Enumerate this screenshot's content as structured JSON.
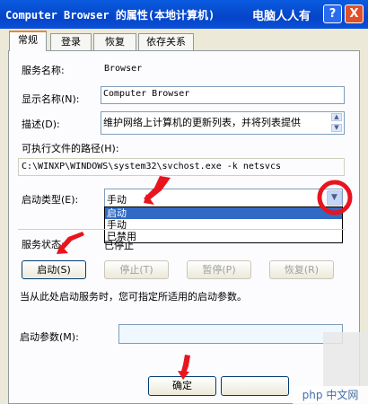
{
  "window": {
    "title": "Computer Browser 的属性(本地计算机)",
    "watermark_top": "电脑人人有",
    "help_label": "?",
    "close_label": "X"
  },
  "tabs": [
    {
      "label": "常规",
      "active": true
    },
    {
      "label": "登录",
      "active": false
    },
    {
      "label": "恢复",
      "active": false
    },
    {
      "label": "依存关系",
      "active": false
    }
  ],
  "general": {
    "service_name_label": "服务名称:",
    "service_name": "Browser",
    "display_name_label": "显示名称(N):",
    "display_name": "Computer Browser",
    "description_label": "描述(D):",
    "description": "维护网络上计算机的更新列表，并将列表提供",
    "exe_path_label": "可执行文件的路径(H):",
    "exe_path": "C:\\WINXP\\WINDOWS\\system32\\svchost.exe -k netsvcs",
    "startup_type_label": "启动类型(E):",
    "startup_type_value": "手动",
    "startup_options": [
      "启动",
      "手动",
      "已禁用"
    ],
    "startup_selected_index": 0,
    "service_status_label": "服务状态:",
    "service_status": "已停止",
    "start_button": "启动(S)",
    "stop_button": "停止(T)",
    "pause_button": "暂停(P)",
    "resume_button": "恢复(R)",
    "hint": "当从此处启动服务时，您可指定所适用的启动参数。",
    "start_params_label": "启动参数(M):",
    "start_params_value": ""
  },
  "footer": {
    "ok_button": "确定"
  },
  "watermark_bottom": "php 中文网",
  "colors": {
    "titlebar": "#0544c8",
    "dialog_bg": "#ece9d8",
    "panel_bg": "#fcfcfe",
    "selection": "#316ac5",
    "annotation_red": "#e8141e"
  }
}
